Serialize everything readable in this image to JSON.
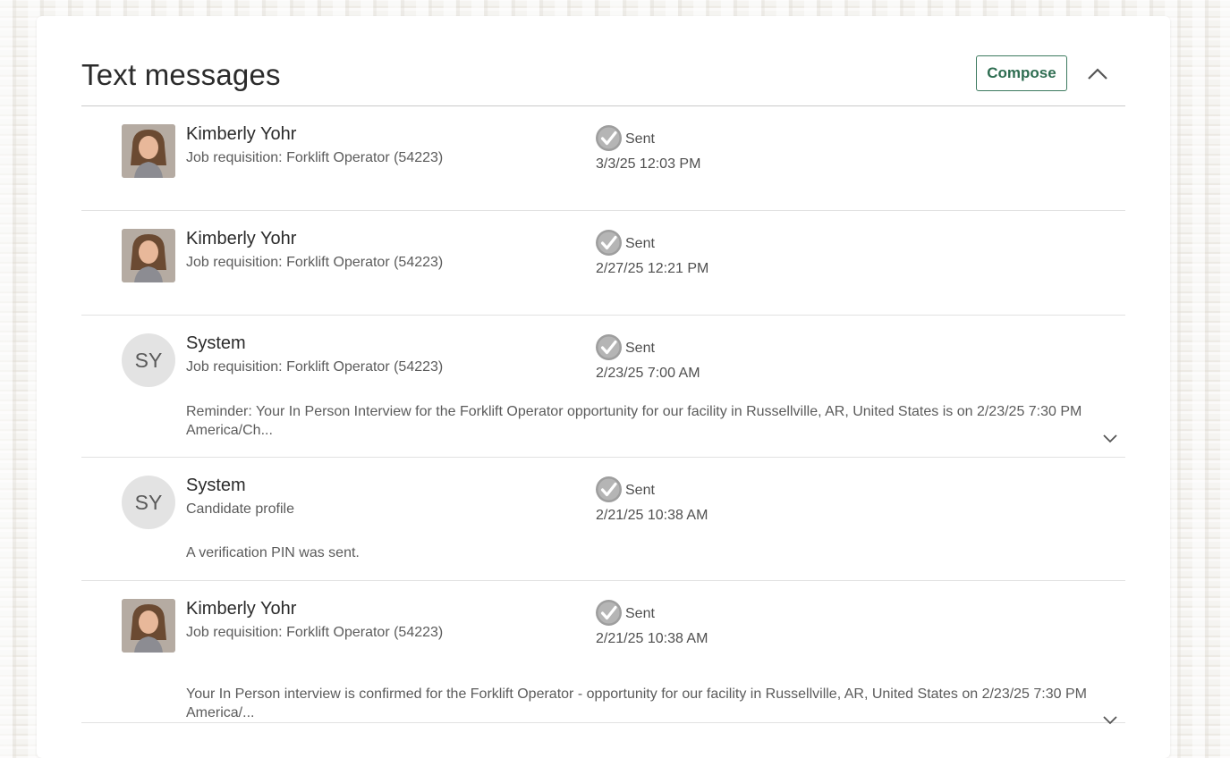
{
  "panel": {
    "title": "Text messages",
    "compose_label": "Compose",
    "collapse_icon": "chevron-up-icon",
    "accent_color": "#2f6e52"
  },
  "messages": [
    {
      "sender": "Kimberly Yohr",
      "avatar": "photo",
      "context": "Job requisition: Forklift Operator (54223)",
      "status": "Sent",
      "status_icon": "check-circle-icon",
      "timestamp": "3/3/25 12:03 PM",
      "body": ""
    },
    {
      "sender": "Kimberly Yohr",
      "avatar": "photo",
      "context": "Job requisition: Forklift Operator (54223)",
      "status": "Sent",
      "status_icon": "check-circle-icon",
      "timestamp": "2/27/25 12:21 PM",
      "body": ""
    },
    {
      "sender": "System",
      "avatar": "initials",
      "initials": "SY",
      "context": "Job requisition: Forklift Operator (54223)",
      "status": "Sent",
      "status_icon": "check-circle-icon",
      "timestamp": "2/23/25 7:00 AM",
      "body": "Reminder: Your In Person Interview for the Forklift Operator opportunity for our facility in Russellville, AR, United States is on 2/23/25 7:30 PM America/Ch...",
      "expand_icon": "chevron-down-icon"
    },
    {
      "sender": "System",
      "avatar": "initials",
      "initials": "SY",
      "context": "Candidate profile",
      "status": "Sent",
      "status_icon": "check-circle-icon",
      "timestamp": "2/21/25 10:38 AM",
      "body": "A verification PIN was sent."
    },
    {
      "sender": "Kimberly Yohr",
      "avatar": "photo",
      "context": "Job requisition: Forklift Operator (54223)",
      "status": "Sent",
      "status_icon": "check-circle-icon",
      "timestamp": "2/21/25 10:38 AM",
      "body": "Your In Person interview is confirmed for the Forklift Operator - opportunity for our facility in Russellville, AR, United States on 2/23/25 7:30 PM America/...",
      "expand_icon": "chevron-down-icon"
    }
  ]
}
